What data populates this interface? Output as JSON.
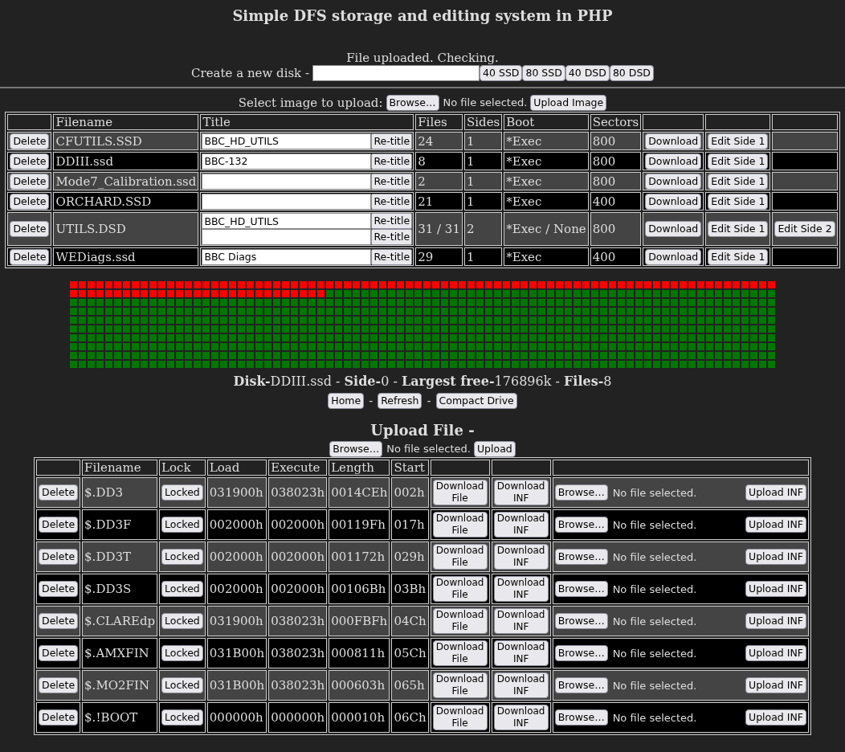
{
  "page_title": "Simple DFS storage and editing system in PHP",
  "status_message": "File uploaded. Checking.",
  "create_disk": {
    "label": "Create a new disk -",
    "buttons": [
      "40 SSD",
      "80 SSD",
      "40 DSD",
      "80 DSD"
    ]
  },
  "image_upload": {
    "label": "Select image to upload:",
    "browse": "Browse…",
    "file_status": "No file selected.",
    "submit": "Upload Image"
  },
  "disks": {
    "columns": [
      "Filename",
      "Title",
      "Files",
      "Sides",
      "Boot",
      "Sectors"
    ],
    "rows": [
      {
        "delete": "Delete",
        "filename": "CFUTILS.SSD",
        "titles": [
          {
            "value": "BBC_HD_UTILS",
            "button": "Re-title"
          }
        ],
        "files": "24",
        "sides": "1",
        "boot": "*Exec",
        "sectors": "800",
        "download": "Download",
        "edits": [
          "Edit Side 1"
        ]
      },
      {
        "delete": "Delete",
        "filename": "DDIII.ssd",
        "titles": [
          {
            "value": "BBC-132",
            "button": "Re-title"
          }
        ],
        "files": "8",
        "sides": "1",
        "boot": "*Exec",
        "sectors": "800",
        "download": "Download",
        "edits": [
          "Edit Side 1"
        ]
      },
      {
        "delete": "Delete",
        "filename": "Mode7_Calibration.ssd",
        "titles": [
          {
            "button": "Re-title"
          }
        ],
        "files": "2",
        "sides": "1",
        "boot": "*Exec",
        "sectors": "800",
        "download": "Download",
        "edits": [
          "Edit Side 1"
        ]
      },
      {
        "delete": "Delete",
        "filename": "ORCHARD.SSD",
        "titles": [
          {
            "button": "Re-title"
          }
        ],
        "files": "21",
        "sides": "1",
        "boot": "*Exec",
        "sectors": "400",
        "download": "Download",
        "edits": [
          "Edit Side 1"
        ]
      },
      {
        "delete": "Delete",
        "filename": "UTILS.DSD",
        "titles": [
          {
            "value": "BBC_HD_UTILS",
            "button": "Re-title"
          },
          {
            "button": "Re-title"
          }
        ],
        "files": "31 / 31",
        "sides": "2",
        "boot": "*Exec / None",
        "sectors": "800",
        "download": "Download",
        "edits": [
          "Edit Side 1",
          "Edit Side 2"
        ]
      },
      {
        "delete": "Delete",
        "filename": "WEDiags.ssd",
        "titles": [
          {
            "value": "BBC Diags",
            "button": "Re-title"
          }
        ],
        "files": "29",
        "sides": "1",
        "boot": "*Exec",
        "sectors": "400",
        "download": "Download",
        "edits": [
          "Edit Side 1"
        ]
      }
    ]
  },
  "sector_map": {
    "rows": [
      [
        true,
        true,
        true,
        true,
        true,
        true,
        true,
        true,
        true,
        true,
        true,
        true,
        true,
        true,
        true,
        true,
        true,
        true,
        true,
        true,
        true,
        true,
        true,
        true,
        true,
        true,
        true,
        true,
        true,
        true,
        true,
        true,
        true,
        true,
        true,
        true,
        true,
        true,
        true,
        true,
        true,
        true,
        true,
        true,
        true,
        true,
        true,
        true,
        true,
        true,
        true,
        true,
        true,
        true,
        true,
        true,
        true,
        true,
        true,
        true,
        true,
        true,
        true,
        true,
        true,
        true,
        true,
        true,
        true,
        true,
        true,
        true,
        true,
        true,
        true,
        true,
        true,
        true,
        true,
        true
      ],
      [
        true,
        true,
        true,
        true,
        true,
        true,
        true,
        true,
        true,
        true,
        true,
        true,
        true,
        true,
        true,
        true,
        true,
        true,
        true,
        true,
        true,
        true,
        true,
        true,
        true,
        true,
        true,
        true,
        true,
        false,
        false,
        false,
        false,
        false,
        false,
        false,
        false,
        false,
        false,
        false,
        false,
        false,
        false,
        false,
        false,
        false,
        false,
        false,
        false,
        false,
        false,
        false,
        false,
        false,
        false,
        false,
        false,
        false,
        false,
        false,
        false,
        false,
        false,
        false,
        false,
        false,
        false,
        false,
        false,
        false,
        false,
        false,
        false,
        false,
        false,
        false,
        false,
        false,
        false,
        false
      ],
      [
        false,
        false,
        false,
        false,
        false,
        false,
        false,
        false,
        false,
        false,
        false,
        false,
        false,
        false,
        false,
        false,
        false,
        false,
        false,
        false,
        false,
        false,
        false,
        false,
        false,
        false,
        false,
        false,
        false,
        false,
        false,
        false,
        false,
        false,
        false,
        false,
        false,
        false,
        false,
        false,
        false,
        false,
        false,
        false,
        false,
        false,
        false,
        false,
        false,
        false,
        false,
        false,
        false,
        false,
        false,
        false,
        false,
        false,
        false,
        false,
        false,
        false,
        false,
        false,
        false,
        false,
        false,
        false,
        false,
        false,
        false,
        false,
        false,
        false,
        false,
        false,
        false,
        false,
        false,
        false
      ],
      [
        false,
        false,
        false,
        false,
        false,
        false,
        false,
        false,
        false,
        false,
        false,
        false,
        false,
        false,
        false,
        false,
        false,
        false,
        false,
        false,
        false,
        false,
        false,
        false,
        false,
        false,
        false,
        false,
        false,
        false,
        false,
        false,
        false,
        false,
        false,
        false,
        false,
        false,
        false,
        false,
        false,
        false,
        false,
        false,
        false,
        false,
        false,
        false,
        false,
        false,
        false,
        false,
        false,
        false,
        false,
        false,
        false,
        false,
        false,
        false,
        false,
        false,
        false,
        false,
        false,
        false,
        false,
        false,
        false,
        false,
        false,
        false,
        false,
        false,
        false,
        false,
        false,
        false,
        false,
        false
      ],
      [
        false,
        false,
        false,
        false,
        false,
        false,
        false,
        false,
        false,
        false,
        false,
        false,
        false,
        false,
        false,
        false,
        false,
        false,
        false,
        false,
        false,
        false,
        false,
        false,
        false,
        false,
        false,
        false,
        false,
        false,
        false,
        false,
        false,
        false,
        false,
        false,
        false,
        false,
        false,
        false,
        false,
        false,
        false,
        false,
        false,
        false,
        false,
        false,
        false,
        false,
        false,
        false,
        false,
        false,
        false,
        false,
        false,
        false,
        false,
        false,
        false,
        false,
        false,
        false,
        false,
        false,
        false,
        false,
        false,
        false,
        false,
        false,
        false,
        false,
        false,
        false,
        false,
        false,
        false,
        false
      ],
      [
        false,
        false,
        false,
        false,
        false,
        false,
        false,
        false,
        false,
        false,
        false,
        false,
        false,
        false,
        false,
        false,
        false,
        false,
        false,
        false,
        false,
        false,
        false,
        false,
        false,
        false,
        false,
        false,
        false,
        false,
        false,
        false,
        false,
        false,
        false,
        false,
        false,
        false,
        false,
        false,
        false,
        false,
        false,
        false,
        false,
        false,
        false,
        false,
        false,
        false,
        false,
        false,
        false,
        false,
        false,
        false,
        false,
        false,
        false,
        false,
        false,
        false,
        false,
        false,
        false,
        false,
        false,
        false,
        false,
        false,
        false,
        false,
        false,
        false,
        false,
        false,
        false,
        false,
        false,
        false
      ],
      [
        false,
        false,
        false,
        false,
        false,
        false,
        false,
        false,
        false,
        false,
        false,
        false,
        false,
        false,
        false,
        false,
        false,
        false,
        false,
        false,
        false,
        false,
        false,
        false,
        false,
        false,
        false,
        false,
        false,
        false,
        false,
        false,
        false,
        false,
        false,
        false,
        false,
        false,
        false,
        false,
        false,
        false,
        false,
        false,
        false,
        false,
        false,
        false,
        false,
        false,
        false,
        false,
        false,
        false,
        false,
        false,
        false,
        false,
        false,
        false,
        false,
        false,
        false,
        false,
        false,
        false,
        false,
        false,
        false,
        false,
        false,
        false,
        false,
        false,
        false,
        false,
        false,
        false,
        false,
        false
      ],
      [
        false,
        false,
        false,
        false,
        false,
        false,
        false,
        false,
        false,
        false,
        false,
        false,
        false,
        false,
        false,
        false,
        false,
        false,
        false,
        false,
        false,
        false,
        false,
        false,
        false,
        false,
        false,
        false,
        false,
        false,
        false,
        false,
        false,
        false,
        false,
        false,
        false,
        false,
        false,
        false,
        false,
        false,
        false,
        false,
        false,
        false,
        false,
        false,
        false,
        false,
        false,
        false,
        false,
        false,
        false,
        false,
        false,
        false,
        false,
        false,
        false,
        false,
        false,
        false,
        false,
        false,
        false,
        false,
        false,
        false,
        false,
        false,
        false,
        false,
        false,
        false,
        false,
        false,
        false,
        false
      ],
      [
        false,
        false,
        false,
        false,
        false,
        false,
        false,
        false,
        false,
        false,
        false,
        false,
        false,
        false,
        false,
        false,
        false,
        false,
        false,
        false,
        false,
        false,
        false,
        false,
        false,
        false,
        false,
        false,
        false,
        false,
        false,
        false,
        false,
        false,
        false,
        false,
        false,
        false,
        false,
        false,
        false,
        false,
        false,
        false,
        false,
        false,
        false,
        false,
        false,
        false,
        false,
        false,
        false,
        false,
        false,
        false,
        false,
        false,
        false,
        false,
        false,
        false,
        false,
        false,
        false,
        false,
        false,
        false,
        false,
        false,
        false,
        false,
        false,
        false,
        false,
        false,
        false,
        false,
        false,
        false
      ],
      [
        false,
        false,
        false,
        false,
        false,
        false,
        false,
        false,
        false,
        false,
        false,
        false,
        false,
        false,
        false,
        false,
        false,
        false,
        false,
        false,
        false,
        false,
        false,
        false,
        false,
        false,
        false,
        false,
        false,
        false,
        false,
        false,
        false,
        false,
        false,
        false,
        false,
        false,
        false,
        false,
        false,
        false,
        false,
        false,
        false,
        false,
        false,
        false,
        false,
        false,
        false,
        false,
        false,
        false,
        false,
        false,
        false,
        false,
        false,
        false,
        false,
        false,
        false,
        false,
        false,
        false,
        false,
        false,
        false,
        false,
        false,
        false,
        false,
        false,
        false,
        false,
        false,
        false,
        false,
        false
      ]
    ]
  },
  "disk_info": "**Disk-**DDIII.ssd - **Side-**0 - **Largest free-**176896k - **Files-**8",
  "nav": [
    {
      "kind": "button",
      "text": "Home"
    },
    {
      "kind": "text",
      "text": "-"
    },
    {
      "kind": "button",
      "text": "Refresh"
    },
    {
      "kind": "text",
      "text": "-"
    },
    {
      "kind": "button",
      "text": "Compact Drive"
    }
  ],
  "file_upload": {
    "heading": "Upload File -",
    "browse": "Browse…",
    "file_status": "No file selected.",
    "submit": "Upload"
  },
  "files": {
    "columns": [
      "Filename",
      "Lock",
      "Load",
      "Execute",
      "Length",
      "Start"
    ],
    "rows": [
      {
        "delete": "Delete",
        "name": "$.DD3",
        "lock": "Locked",
        "load": "031900h",
        "exec": "038023h",
        "length": "0014CEh",
        "start": "002h",
        "download_file": "Download File",
        "download_inf": "Download INF",
        "browse": "Browse…",
        "file_status": "No file selected.",
        "upload": "Upload INF"
      },
      {
        "delete": "Delete",
        "name": "$.DD3F",
        "lock": "Locked",
        "load": "002000h",
        "exec": "002000h",
        "length": "00119Fh",
        "start": "017h",
        "download_file": "Download File",
        "download_inf": "Download INF",
        "browse": "Browse…",
        "file_status": "No file selected.",
        "upload": "Upload INF"
      },
      {
        "delete": "Delete",
        "name": "$.DD3T",
        "lock": "Locked",
        "load": "002000h",
        "exec": "002000h",
        "length": "001172h",
        "start": "029h",
        "download_file": "Download File",
        "download_inf": "Download INF",
        "browse": "Browse…",
        "file_status": "No file selected.",
        "upload": "Upload INF"
      },
      {
        "delete": "Delete",
        "name": "$.DD3S",
        "lock": "Locked",
        "load": "002000h",
        "exec": "002000h",
        "length": "00106Bh",
        "start": "03Bh",
        "download_file": "Download File",
        "download_inf": "Download INF",
        "browse": "Browse…",
        "file_status": "No file selected.",
        "upload": "Upload INF"
      },
      {
        "delete": "Delete",
        "name": "$.CLAREdp",
        "lock": "Locked",
        "load": "031900h",
        "exec": "038023h",
        "length": "000FBFh",
        "start": "04Ch",
        "download_file": "Download File",
        "download_inf": "Download INF",
        "browse": "Browse…",
        "file_status": "No file selected.",
        "upload": "Upload INF"
      },
      {
        "delete": "Delete",
        "name": "$.AMXFIN",
        "lock": "Locked",
        "load": "031B00h",
        "exec": "038023h",
        "length": "000811h",
        "start": "05Ch",
        "download_file": "Download File",
        "download_inf": "Download INF",
        "browse": "Browse…",
        "file_status": "No file selected.",
        "upload": "Upload INF"
      },
      {
        "delete": "Delete",
        "name": "$.MO2FIN",
        "lock": "Locked",
        "load": "031B00h",
        "exec": "038023h",
        "length": "000603h",
        "start": "065h",
        "download_file": "Download File",
        "download_inf": "Download INF",
        "browse": "Browse…",
        "file_status": "No file selected.",
        "upload": "Upload INF"
      },
      {
        "delete": "Delete",
        "name": "$.!BOOT",
        "lock": "Locked",
        "load": "000000h",
        "exec": "000000h",
        "length": "000010h",
        "start": "06Ch",
        "download_file": "Download File",
        "download_inf": "Download INF",
        "browse": "Browse…",
        "file_status": "No file selected.",
        "upload": "Upload INF"
      }
    ]
  }
}
